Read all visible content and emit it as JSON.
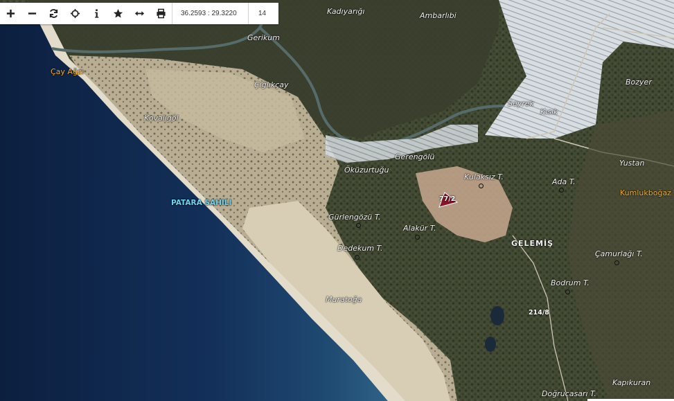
{
  "toolbar": {
    "buttons": [
      {
        "name": "zoom-in-button",
        "icon": "plus-icon"
      },
      {
        "name": "zoom-out-button",
        "icon": "minus-icon"
      },
      {
        "name": "refresh-button",
        "icon": "refresh-icon"
      },
      {
        "name": "locate-button",
        "icon": "crosshair-icon"
      },
      {
        "name": "info-button",
        "icon": "info-icon"
      },
      {
        "name": "favorite-button",
        "icon": "star-icon"
      },
      {
        "name": "measure-button",
        "icon": "arrows-horizontal-icon"
      },
      {
        "name": "print-button",
        "icon": "printer-icon"
      }
    ],
    "coordinates": "36.2593 : 29.3220",
    "zoom_level": "14"
  },
  "labels": {
    "kadiyarigi": "Kadıyarığı",
    "ambarlibi": "Ambarlıbi",
    "gerikum": "Gerikum",
    "cay_agzi": "Çay Ağzı",
    "ciglikcay": "Çığlıkçay",
    "bozyer": "Bozyer",
    "seyrek": "Seyrek",
    "kisik": "Kısık",
    "kovaligol": "Kovalıgöl",
    "gerengolu": "Gerengölü",
    "okuzurtugu": "Öküzurtuğu",
    "yustan": "Yustan",
    "kulaksiz": "Kulaksız T.",
    "ada": "Ada T.",
    "kumlukbogaz": "Kumlukboğaz",
    "patara": "PATARA SAHILI",
    "parcel1": "77/2",
    "gurlengozu": "Gürlengözü T.",
    "alakur": "Alakür T.",
    "gelemis": "GELEMİŞ",
    "dedekum": "Dedekum T.",
    "camurlagi": "Çamurlağı T.",
    "bodrum": "Bodrum T.",
    "muratoga": "Muratoğa",
    "parcel2": "214/8",
    "kapikuran": "Kapıkuran",
    "dogrucasari": "Doğrucasarı T."
  },
  "colors": {
    "sea_deep": "#0f2448",
    "sea_shore": "#2c5d82",
    "sand": "#d7ccb2",
    "vegetation": "#3f4631",
    "greenhouse": "#dde2e6",
    "label_orange": "#f3b233",
    "label_beach": "#6fd3ee",
    "parcel_fill": "#8b1228"
  }
}
